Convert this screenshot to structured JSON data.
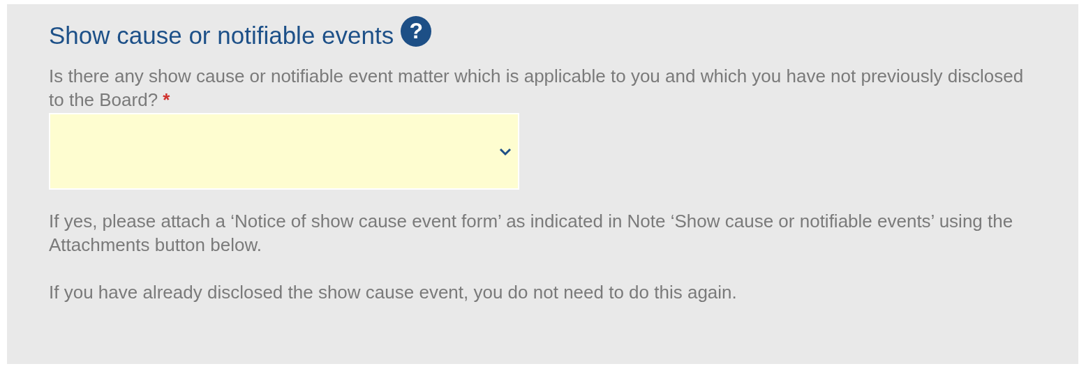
{
  "section": {
    "title": "Show cause or notifiable events",
    "help_icon": "?",
    "question": {
      "text": "Is there any show cause or notifiable event matter which is applicable to you and which you have not previously disclosed to the Board?",
      "required_mark": "*"
    },
    "notes": [
      "If yes, please attach a ‘Notice of show cause event form’ as indicated in Note ‘Show cause or notifiable events’ using the Attachments button below.",
      "If you have already disclosed the show cause event, you do not need to do this again."
    ]
  }
}
